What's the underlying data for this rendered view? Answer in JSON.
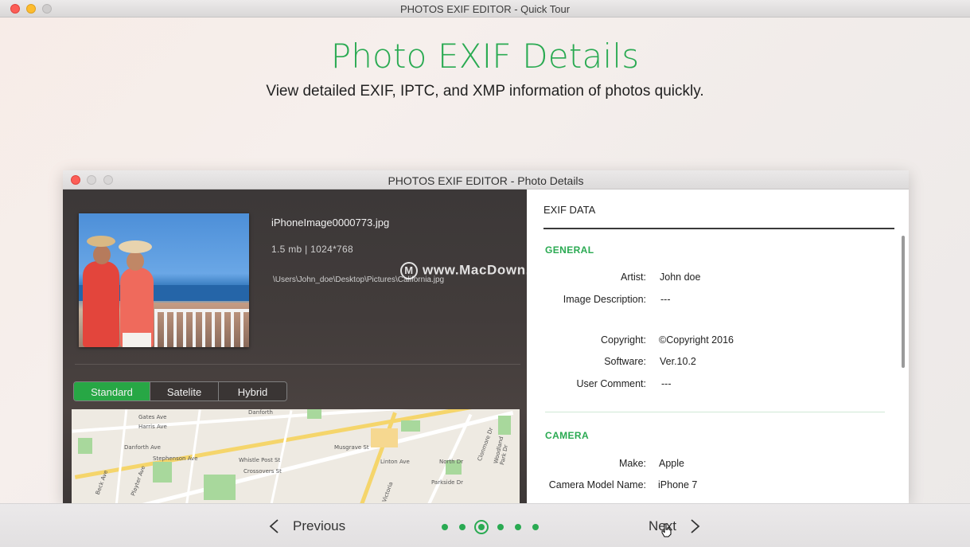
{
  "window": {
    "title": "PHOTOS EXIF EDITOR - Quick Tour"
  },
  "hero": {
    "title": "Photo EXIF Details",
    "subtitle": "View detailed EXIF, IPTC, and XMP information of photos quickly."
  },
  "inner_window": {
    "title": "PHOTOS EXIF EDITOR - Photo Details",
    "file": {
      "name": "iPhoneImage0000773.jpg",
      "meta": "1.5 mb | 1024*768",
      "path": "\\Users\\John_doe\\Desktop\\Pictures\\California.jpg"
    },
    "map_tabs": [
      "Standard",
      "Satelite",
      "Hybrid"
    ],
    "map_labels": [
      "Gates Ave",
      "Harris Ave",
      "Danforth Ave",
      "Danforth",
      "Stephenson Ave",
      "Whistle Post St",
      "Crossovers St",
      "Musgrave St",
      "Linton Ave",
      "North Dr",
      "Clonmore Dr",
      "Woodland Park Dr",
      "Parkside Dr",
      "Beck Ave",
      "Playter Ave",
      "Victoria"
    ],
    "exif": {
      "header": "EXIF DATA",
      "general": {
        "heading": "GENERAL",
        "rows": [
          {
            "key": "Artist:",
            "value": "John doe"
          },
          {
            "key": "Image Description:",
            "value": "---"
          },
          {
            "key": "Copyright:",
            "value": "©Copyright 2016"
          },
          {
            "key": "Software:",
            "value": "Ver.10.2"
          },
          {
            "key": "User Comment:",
            "value": "---"
          }
        ]
      },
      "camera": {
        "heading": "CAMERA",
        "rows": [
          {
            "key": "Make:",
            "value": "Apple"
          },
          {
            "key": "Camera Model Name:",
            "value": "iPhone 7"
          }
        ]
      }
    }
  },
  "watermark": {
    "icon": "M",
    "text": "www.MacDown.com"
  },
  "nav": {
    "previous": "Previous",
    "next": "Next",
    "pages": 6,
    "current_page": 3
  },
  "colors": {
    "accent": "#2aaa52",
    "dark_panel": "#3f3a39"
  }
}
